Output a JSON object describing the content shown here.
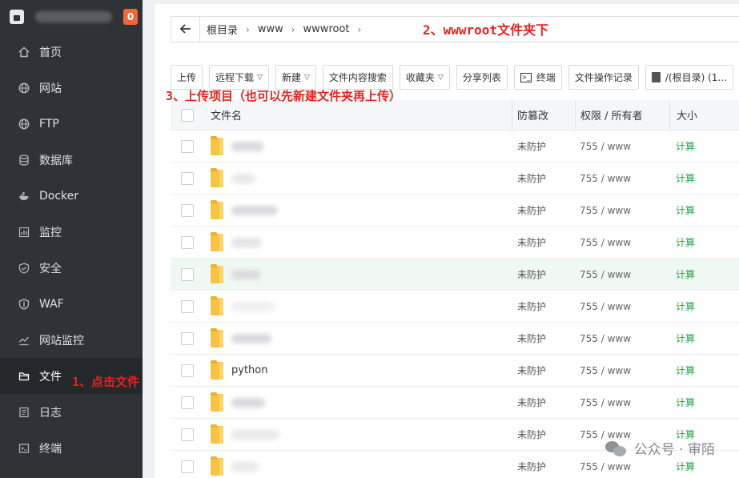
{
  "sidebar": {
    "badge": "0",
    "items": [
      {
        "label": "首页",
        "icon": "home-icon"
      },
      {
        "label": "网站",
        "icon": "globe-icon"
      },
      {
        "label": "FTP",
        "icon": "globe-icon"
      },
      {
        "label": "数据库",
        "icon": "database-icon"
      },
      {
        "label": "Docker",
        "icon": "docker-icon"
      },
      {
        "label": "监控",
        "icon": "monitor-icon"
      },
      {
        "label": "安全",
        "icon": "shield-icon"
      },
      {
        "label": "WAF",
        "icon": "waf-shield-icon"
      },
      {
        "label": "网站监控",
        "icon": "chart-icon"
      },
      {
        "label": "文件",
        "icon": "folder-icon",
        "active": true
      },
      {
        "label": "日志",
        "icon": "log-icon"
      },
      {
        "label": "终端",
        "icon": "terminal-icon"
      }
    ]
  },
  "breadcrumb": {
    "back_icon": "arrow-left-icon",
    "parts": [
      "根目录",
      "www",
      "wwwroot"
    ]
  },
  "toolbar": {
    "upload": "上传",
    "remote_download": "远程下载",
    "new": "新建",
    "content_search": "文件内容搜索",
    "favorites": "收藏夹",
    "share_list": "分享列表",
    "terminal": "终端",
    "file_log": "文件操作记录",
    "disk": "/(根目录) (1..."
  },
  "table": {
    "headers": {
      "name": "文件名",
      "protect": "防篡改",
      "perm": "权限 / 所有者",
      "size": "大小"
    },
    "rows": [
      {
        "name": "",
        "protect": "未防护",
        "perm": "755 / www",
        "size": "计算"
      },
      {
        "name": "",
        "protect": "未防护",
        "perm": "755 / www",
        "size": "计算"
      },
      {
        "name": "",
        "protect": "未防护",
        "perm": "755 / www",
        "size": "计算"
      },
      {
        "name": "",
        "protect": "未防护",
        "perm": "755 / www",
        "size": "计算"
      },
      {
        "name": "",
        "protect": "未防护",
        "perm": "755 / www",
        "size": "计算",
        "highlight": true
      },
      {
        "name": "",
        "protect": "未防护",
        "perm": "755 / www",
        "size": "计算"
      },
      {
        "name": "",
        "protect": "未防护",
        "perm": "755 / www",
        "size": "计算"
      },
      {
        "name": "python",
        "protect": "未防护",
        "perm": "755 / www",
        "size": "计算"
      },
      {
        "name": "",
        "protect": "未防护",
        "perm": "755 / www",
        "size": "计算"
      },
      {
        "name": "",
        "protect": "未防护",
        "perm": "755 / www",
        "size": "计算"
      },
      {
        "name": "",
        "protect": "未防护",
        "perm": "755 / www",
        "size": "计算"
      }
    ]
  },
  "annotations": {
    "step1": "1、点击文件",
    "step2": "2、wwwroot文件夹下",
    "step3": "3、上传项目（也可以先新建文件夹再上传）"
  },
  "watermark": "公众号 · 审陌",
  "colors": {
    "sidebar_bg": "#2f3337",
    "accent_green": "#20a53a",
    "annotation_red": "#e8231e",
    "badge_orange": "#f0683a"
  }
}
